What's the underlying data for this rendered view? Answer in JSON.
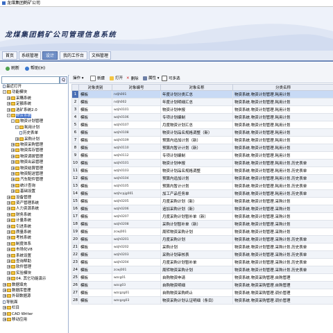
{
  "window": {
    "title": "龙煤集团鹤矿公司"
  },
  "banner": {
    "title": "龙煤集团鹤矿公司管理信息系统"
  },
  "menu": {
    "tabs": [
      {
        "label": "首页",
        "active": false
      },
      {
        "label": "系统管理",
        "active": false
      },
      {
        "label": "设计",
        "active": true
      },
      {
        "label": "我的工作台",
        "active": false
      },
      {
        "label": "文档管理",
        "active": false
      }
    ]
  },
  "toolbar": {
    "refresh": "刷新",
    "help": "帮助(H)"
  },
  "search": {
    "button": "Q"
  },
  "tree": {
    "nodes": [
      {
        "label": "最近打开",
        "level": 0,
        "kind": "doc"
      },
      {
        "label": "功能模块",
        "level": 0,
        "kind": "folder",
        "expander": "-"
      },
      {
        "label": "采購系统",
        "level": 1,
        "kind": "folder",
        "expander": "+"
      },
      {
        "label": "定額系统",
        "level": 1,
        "kind": "folder",
        "expander": "+"
      },
      {
        "label": "选矿系统2.0",
        "level": 1,
        "kind": "folder",
        "expander": "+"
      },
      {
        "label": "物资系统",
        "level": 1,
        "kind": "folder",
        "expander": "-",
        "selected": true
      },
      {
        "label": "物资计划管理",
        "level": 2,
        "kind": "folder",
        "expander": "-"
      },
      {
        "label": "耗用计划",
        "level": 3,
        "kind": "folder",
        "expander": "-"
      },
      {
        "label": "历史表单",
        "level": 4,
        "kind": "doc"
      },
      {
        "label": "采购计划",
        "level": 3,
        "kind": "folder",
        "expander": "+"
      },
      {
        "label": "物资采购管理",
        "level": 2,
        "kind": "folder",
        "expander": "+"
      },
      {
        "label": "物资库存管理",
        "level": 2,
        "kind": "folder",
        "expander": "+"
      },
      {
        "label": "物资调拨管理",
        "level": 2,
        "kind": "folder",
        "expander": "+"
      },
      {
        "label": "物资出品管理",
        "level": 2,
        "kind": "folder",
        "expander": "+"
      },
      {
        "label": "物资结算管理",
        "level": 2,
        "kind": "folder",
        "expander": "+"
      },
      {
        "label": "物资配送管理",
        "level": 2,
        "kind": "folder",
        "expander": "+"
      },
      {
        "label": "汽车配件管理",
        "level": 2,
        "kind": "folder",
        "expander": "+"
      },
      {
        "label": "统计查询",
        "level": 2,
        "kind": "folder",
        "expander": "+"
      },
      {
        "label": "基础设置",
        "level": 2,
        "kind": "folder",
        "expander": "+"
      },
      {
        "label": "设备管理",
        "level": 1,
        "kind": "folder",
        "expander": "+"
      },
      {
        "label": "资产管理系统",
        "level": 1,
        "kind": "folder",
        "expander": "+"
      },
      {
        "label": "人力资源系统",
        "level": 1,
        "kind": "folder",
        "expander": "+"
      },
      {
        "label": "财务系统",
        "level": 1,
        "kind": "folder",
        "expander": "+"
      },
      {
        "label": "计量系统",
        "level": 1,
        "kind": "folder",
        "expander": "+"
      },
      {
        "label": "引进系统",
        "level": 1,
        "kind": "folder",
        "expander": "+"
      },
      {
        "label": "质量系统",
        "level": 1,
        "kind": "folder",
        "expander": "+"
      },
      {
        "label": "考核系统",
        "level": 1,
        "kind": "folder",
        "expander": "+"
      },
      {
        "label": "制度体系",
        "level": 1,
        "kind": "folder",
        "expander": "+"
      },
      {
        "label": "市场化V8",
        "level": 1,
        "kind": "folder",
        "expander": "+"
      },
      {
        "label": "系统设置",
        "level": 1,
        "kind": "folder",
        "expander": "+"
      },
      {
        "label": "查询帮助",
        "level": 1,
        "kind": "folder",
        "expander": "+"
      },
      {
        "label": "软件管理",
        "level": 1,
        "kind": "folder",
        "expander": "+"
      },
      {
        "label": "实验模块",
        "level": 1,
        "kind": "folder",
        "expander": "+"
      },
      {
        "label": "04. 其它功能演示",
        "level": 1,
        "kind": "folder",
        "expander": "+"
      },
      {
        "label": "数据填充",
        "level": 0,
        "kind": "folder",
        "expander": "+"
      },
      {
        "label": "数据库管理",
        "level": 0,
        "kind": "folder",
        "expander": "+"
      },
      {
        "label": "外部数据源",
        "level": 0,
        "kind": "folder",
        "expander": "+"
      },
      {
        "label": "导航面",
        "level": 0,
        "kind": "doc"
      },
      {
        "label": "栏目",
        "level": 0,
        "kind": "folder",
        "expander": "+"
      },
      {
        "label": "CAD Writer",
        "level": 0,
        "kind": "folder",
        "expander": "+"
      },
      {
        "label": "移动应用",
        "level": 0,
        "kind": "folder",
        "expander": "+"
      }
    ]
  },
  "grid_tools": {
    "ops": "操作",
    "new": "新建",
    "open": "打开",
    "delete": "删除",
    "props": "属性",
    "multi": "可多选"
  },
  "table": {
    "columns": [
      "",
      "对象类别",
      "对象编号",
      "对象名称",
      "分类名称"
    ],
    "rows": [
      [
        "1",
        "模板",
        "ndjh001",
        "年度计划分类汇总",
        "物资系统.物资计划管理.耗用计划"
      ],
      [
        "2",
        "模板",
        "ndjh002",
        "年度计划明细汇总",
        "物资系统.物资计划管理.耗用计划"
      ],
      [
        "3",
        "模板",
        "wzjh0101",
        "物资计划申报",
        "物资系统.物资计划管理.耗用计划"
      ],
      [
        "4",
        "模板",
        "wzjh0106",
        "专项计划编制",
        "物资系统.物资计划管理.耗用计划"
      ],
      [
        "5",
        "模板",
        "wzjh0107",
        "月度物资计划汇总",
        "物资系统.物资计划管理.耗用计划"
      ],
      [
        "6",
        "模板",
        "wzjh0108",
        "物资计划品名规格调整（新）",
        "物资系统.物资计划管理.耗用计划"
      ],
      [
        "7",
        "模板",
        "wzjh0109",
        "预算内追加计划（新）",
        "物资系统.物资计划管理.耗用计划"
      ],
      [
        "8",
        "模板",
        "wzjh0110",
        "预算内暂计计划（新）",
        "物资系统.物资计划管理.耗用计划"
      ],
      [
        "9",
        "模板",
        "wzjh0112",
        "专项计划编制",
        "物资系统.物资计划管理.耗用计划"
      ],
      [
        "10",
        "模板",
        "wzjh0101",
        "物资计划申报",
        "物资系统.物资计划管理.耗用计划.历史表单"
      ],
      [
        "11",
        "模板",
        "wzjh0103",
        "物资计划品名规格调整",
        "物资系统.物资计划管理.耗用计划.历史表单"
      ],
      [
        "12",
        "模板",
        "wzjh0104",
        "预算内追加计划",
        "物资系统.物资计划管理.耗用计划.历史表单"
      ],
      [
        "13",
        "模板",
        "wzjh0105",
        "预算内暂计计划",
        "物资系统.物资计划管理.耗用计划.历史表单"
      ],
      [
        "14",
        "模板",
        "wzjhcpjg001",
        "加工产品任务单",
        "物资系统.物资计划管理.耗用计划.历史表单"
      ],
      [
        "15",
        "模板",
        "wzjh0205",
        "月度采购计划（新）",
        "物资系统.物资计划管理.采购计划"
      ],
      [
        "16",
        "模板",
        "wzjh0206",
        "追加采购计划（新）",
        "物资系统.物资计划管理.采购计划"
      ],
      [
        "17",
        "模板",
        "wzjh0207",
        "月度采购计划暂补单（新）",
        "物资系统.物资计划管理.采购计划"
      ],
      [
        "18",
        "模板",
        "wzjh0208",
        "采购计划暂补单（新）",
        "物资系统.物资计划管理.采购计划"
      ],
      [
        "19",
        "模板",
        "zcwj001",
        "周转物资采购计划",
        "物资系统.物资计划管理.采购计划"
      ],
      [
        "20",
        "模板",
        "wzjh0201",
        "月度采购计划",
        "物资系统.物资计划管理.采购计划.历史表单"
      ],
      [
        "21",
        "模板",
        "wzjh0202",
        "采购计划",
        "物资系统.物资计划管理.采购计划.历史表单"
      ],
      [
        "22",
        "模板",
        "wzjh0203",
        "采购计划审核表",
        "物资系统.物资计划管理.采购计划.历史表单"
      ],
      [
        "23",
        "模板",
        "wzjh0204",
        "月度采购计划暂补单",
        "物资系统.物资计划管理.采购计划.历史表单"
      ],
      [
        "24",
        "模板",
        "zcwj001",
        "周转物资采购计划",
        "物资系统.物资计划管理.采购计划.历史表单"
      ],
      [
        "25",
        "模板",
        "wzcg01",
        "自购物资申请",
        "物资系统.物资采购管理.自购管理"
      ],
      [
        "26",
        "模板",
        "wzcg03",
        "自购物资明细",
        "物资系统.物资采购管理.自购管理"
      ],
      [
        "27",
        "模板",
        "wzcgzg01",
        "自购物资采购终止",
        "物资系统.物资采购管理.调价管理"
      ],
      [
        "28",
        "模板",
        "wzcgzg03",
        "物资采购计划认证明细（条目）",
        "物资系统.物资采购管理.调价管理"
      ]
    ]
  },
  "colors": {
    "accent": "#3163c5",
    "tab_active": "#6f8fc7",
    "header_bg": "#e9edf5",
    "folder": "#f4c542"
  }
}
